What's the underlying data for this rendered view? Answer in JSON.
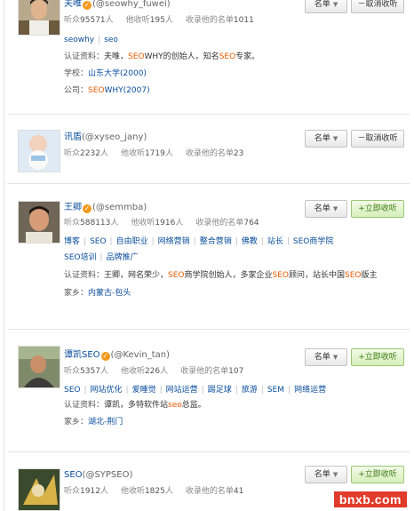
{
  "labels": {
    "followers": "听众",
    "following": "他收听",
    "in_lists": "收录他的名单",
    "unit_person": "人",
    "cert": "认证资料：",
    "school": "学校：",
    "company": "公司：",
    "hometown": "家乡：",
    "list_btn": "名单",
    "unfollow_btn": "取消收听",
    "follow_btn": "立即收听"
  },
  "users": [
    {
      "name": "夫唯",
      "handle": "(@seowhy_fuwei)",
      "followers": "95571",
      "following": "195",
      "lists": "1011",
      "tags": [
        "seowhy",
        "seo"
      ],
      "cert_parts": [
        "夫唯，",
        "SEO",
        "WHY的创始人，知名",
        "SEO",
        "专家。"
      ],
      "school": "山东大学(2000)",
      "company_parts": [
        "SEO",
        "WHY(2007)"
      ]
    },
    {
      "name": "讯盾",
      "handle": "(@xyseo_jany)",
      "followers": "2232",
      "following": "1719",
      "lists": "23"
    },
    {
      "name": "王卿",
      "handle": "(@semmba)",
      "followers": "588113",
      "following": "1916",
      "lists": "764",
      "tags": [
        "博客",
        "SEO",
        "自由职业",
        "网络营销",
        "整合营销",
        "佛教",
        "站长",
        "SEO商学院"
      ],
      "tags2": [
        "SEO培训",
        "品牌推广"
      ],
      "cert_parts": [
        "王卿，网名荣少，",
        "SEO",
        "商学院创始人，多家企业",
        "SEO",
        "顾问，站长中国",
        "SEO",
        "版主"
      ],
      "hometown": "内蒙古-包头"
    },
    {
      "name": "谭凯SEO",
      "handle": "(@Kevin_tan)",
      "followers": "5357",
      "following": "226",
      "lists": "107",
      "tags": [
        "SEO",
        "网站优化",
        "爱睡觉",
        "网站运营",
        "踢足球",
        "旅游",
        "SEM",
        "网络运营"
      ],
      "cert_parts": [
        "谭凯，多特软件站",
        "seo",
        "总监。"
      ],
      "hometown": "湖北-荆门"
    },
    {
      "name": "SEO",
      "handle": "(@SYPSEO)",
      "followers": "1912",
      "following": "1825",
      "lists": "41"
    }
  ],
  "watermark": "bnxb.com"
}
